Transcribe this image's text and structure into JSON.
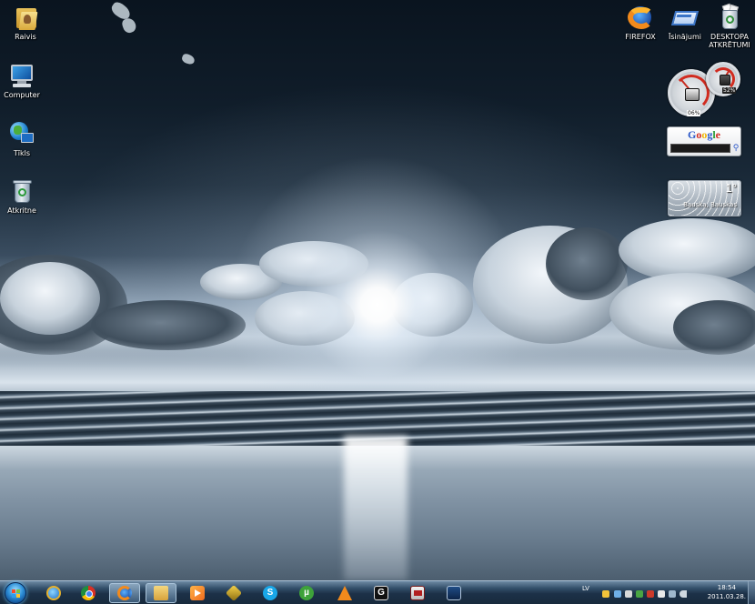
{
  "desktop": {
    "left_icons": [
      {
        "label": "Raivis",
        "icon": "user-folder-icon"
      },
      {
        "label": "Computer",
        "icon": "computer-icon"
      },
      {
        "label": "Tīkls",
        "icon": "network-icon"
      },
      {
        "label": "Atkritne",
        "icon": "recycle-bin-icon"
      }
    ],
    "right_icons": [
      {
        "label": "FIREFOX",
        "icon": "firefox-icon"
      },
      {
        "label": "Īsinājumi",
        "icon": "shortcuts-icon"
      },
      {
        "label_line1": "DESKTOPA",
        "label_line2": "ATKRĒTUMI",
        "icon": "full-recycle-bin-icon"
      }
    ]
  },
  "gadgets": {
    "cpu_meter": {
      "cpu_percent": "06%",
      "ram_percent": "52%"
    },
    "google": {
      "logo_letters": [
        "G",
        "o",
        "o",
        "g",
        "l",
        "e"
      ],
      "search_value": ""
    },
    "weather": {
      "temperature": "1°",
      "location": "Bauska, Bauskas"
    }
  },
  "taskbar": {
    "pinned": [
      "internet-explorer-icon",
      "chrome-icon",
      "firefox-icon",
      "folder-icon",
      "media-player-icon",
      "winamp-icon",
      "skype-icon",
      "utorrent-icon",
      "vlc-icon",
      "gers-icon",
      "gadget-app-icon",
      "show-desktop-app-icon"
    ],
    "skype_glyph": "S",
    "utorrent_glyph": "µ",
    "gers_glyph": "G",
    "language": "LV",
    "time": "18:54",
    "date": "2011.03.28."
  },
  "colors": {
    "taskbar": "#1c3148",
    "accent": "#2e8fd8"
  }
}
